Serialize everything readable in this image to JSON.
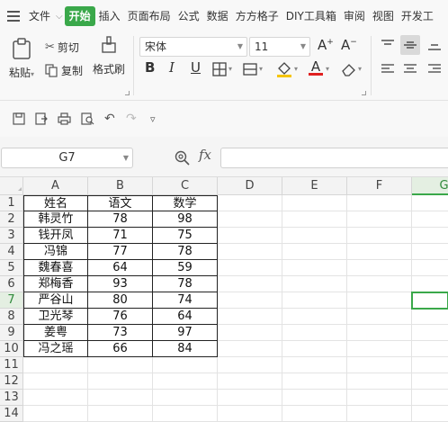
{
  "menubar": {
    "items": [
      "文件",
      "开始",
      "插入",
      "页面布局",
      "公式",
      "数据",
      "方方格子",
      "DIY工具箱",
      "审阅",
      "视图",
      "开发工"
    ],
    "active_index": 1
  },
  "ribbon": {
    "paste_label": "粘贴",
    "cut_label": "剪切",
    "copy_label": "复制",
    "format_painter_label": "格式刷",
    "font_name": "宋体",
    "font_size": "11",
    "bold": "B",
    "italic": "I",
    "underline": "U",
    "font_color_letter": "A",
    "grow_font": "A",
    "shrink_font": "A"
  },
  "formula_bar": {
    "name_box": "G7",
    "fx_label": "fx",
    "formula": ""
  },
  "sheet": {
    "columns": [
      "A",
      "B",
      "C",
      "D",
      "E",
      "F",
      "G"
    ],
    "selected_column": "G",
    "rows": [
      "1",
      "2",
      "3",
      "4",
      "5",
      "6",
      "7",
      "8",
      "9",
      "10",
      "11",
      "12",
      "13",
      "14"
    ],
    "selected_row": "7",
    "header": [
      "姓名",
      "语文",
      "数学"
    ],
    "data": [
      [
        "韩灵竹",
        "78",
        "98"
      ],
      [
        "钱开凤",
        "71",
        "75"
      ],
      [
        "冯锦",
        "77",
        "78"
      ],
      [
        "魏春喜",
        "64",
        "59"
      ],
      [
        "郑梅香",
        "93",
        "78"
      ],
      [
        "严谷山",
        "80",
        "74"
      ],
      [
        "卫光琴",
        "76",
        "64"
      ],
      [
        "姜粤",
        "73",
        "97"
      ],
      [
        "冯之瑶",
        "66",
        "84"
      ]
    ]
  },
  "colors": {
    "accent": "#3aa84a"
  }
}
